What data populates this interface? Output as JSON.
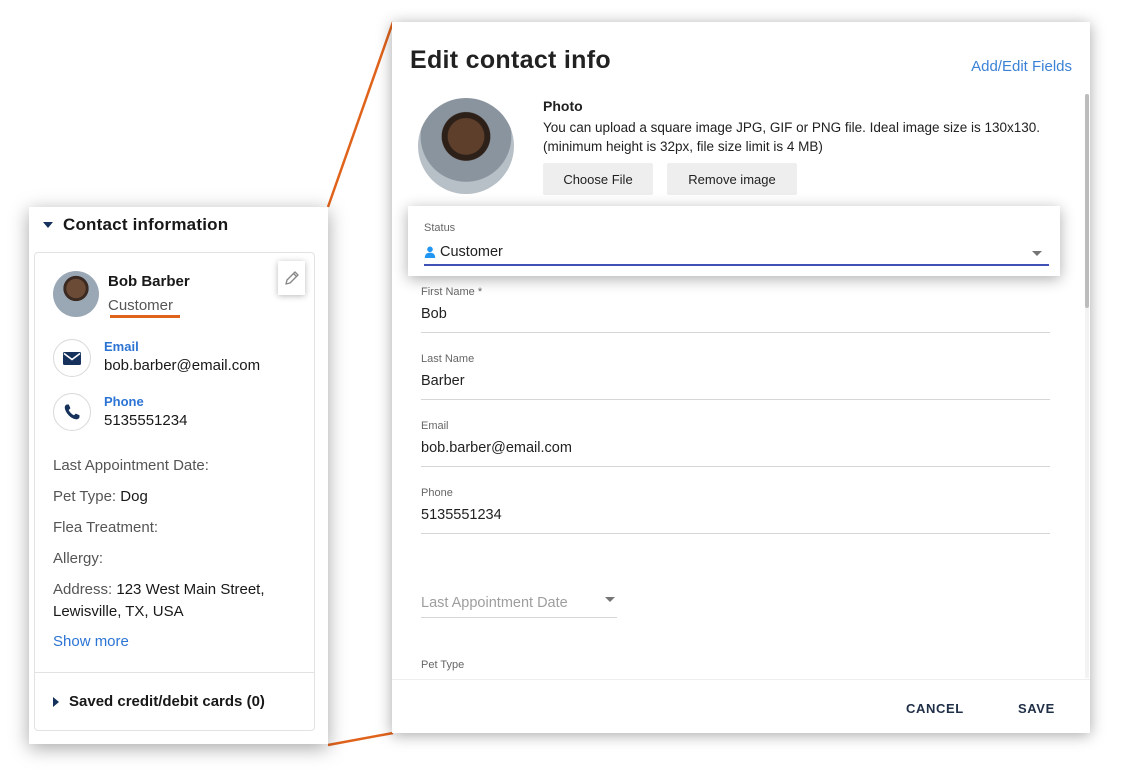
{
  "contact_card": {
    "section_title": "Contact information",
    "name": "Bob Barber",
    "status": "Customer",
    "email_label": "Email",
    "email": "bob.barber@email.com",
    "phone_label": "Phone",
    "phone": "5135551234",
    "fields": [
      {
        "label": "Last Appointment Date:",
        "value": ""
      },
      {
        "label": "Pet Type:",
        "value": "Dog"
      },
      {
        "label": "Flea Treatment:",
        "value": ""
      },
      {
        "label": "Allergy:",
        "value": ""
      },
      {
        "label": "Address:",
        "value": "123 West Main Street,",
        "value2": "Lewisville, TX, USA"
      }
    ],
    "show_more": "Show more",
    "saved_cards": "Saved credit/debit cards (0)"
  },
  "dialog": {
    "title": "Edit contact info",
    "add_edit_fields": "Add/Edit Fields",
    "photo_heading": "Photo",
    "photo_desc": "You can upload a square image JPG, GIF or PNG file. Ideal image size is 130x130. (minimum height is 32px, file size limit is 4 MB)",
    "choose_file": "Choose File",
    "remove_image": "Remove image",
    "status_label": "Status",
    "status_value": "Customer",
    "fields": [
      {
        "label": "First Name *",
        "value": "Bob"
      },
      {
        "label": "Last Name",
        "value": "Barber"
      },
      {
        "label": "Email",
        "value": "bob.barber@email.com"
      },
      {
        "label": "Phone",
        "value": "5135551234"
      }
    ],
    "last_appointment_placeholder": "Last Appointment Date",
    "pet_type_label": "Pet Type",
    "cancel": "CANCEL",
    "save": "SAVE"
  },
  "colors": {
    "accent_orange": "#e0631c",
    "link_blue": "#2c74d4",
    "navy": "#16325c",
    "focus_underline": "#3f51b5"
  }
}
